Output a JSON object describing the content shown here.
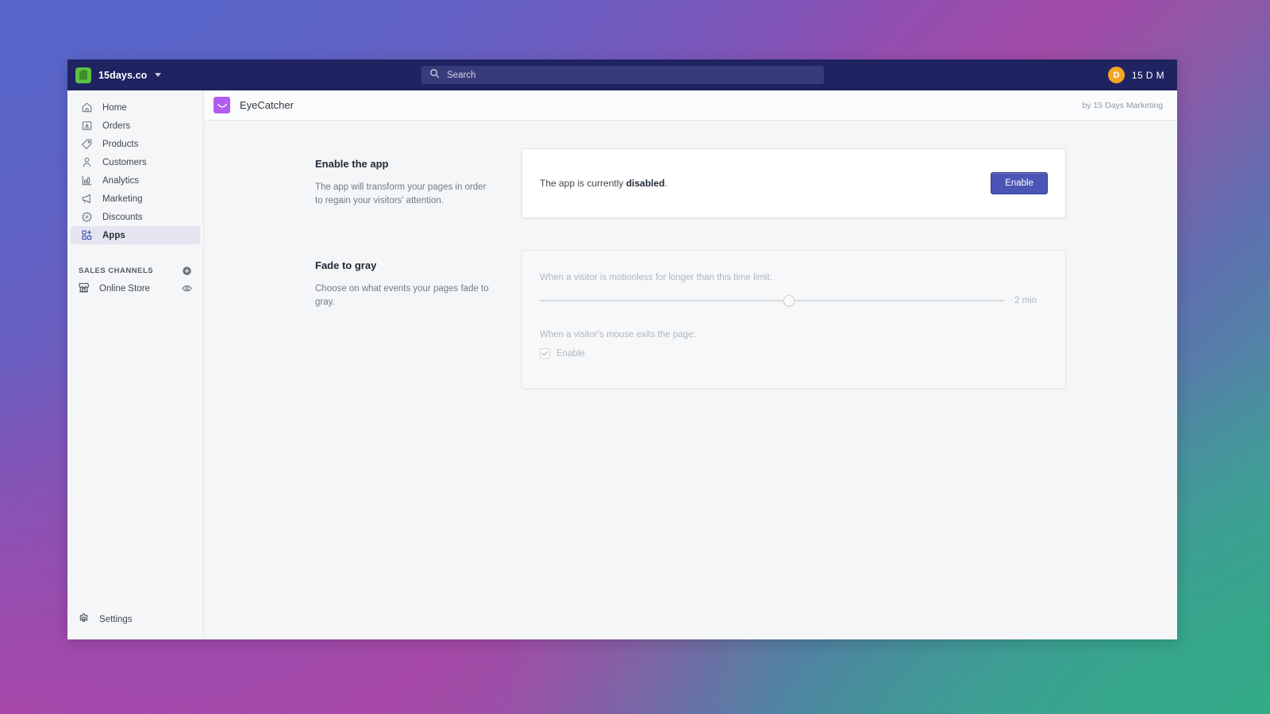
{
  "topbar": {
    "logo_icon": "shopify-bag-icon",
    "shop_name": "15days.co",
    "shop_caret_icon": "chevron-down-icon",
    "search": {
      "icon": "search-icon",
      "placeholder": "Search",
      "value": ""
    },
    "user": {
      "avatar_initial": "D",
      "avatar_color": "#f5a623",
      "label": "15 D M"
    }
  },
  "sidebar": {
    "items": [
      {
        "label": "Home",
        "icon": "home-icon",
        "active": false
      },
      {
        "label": "Orders",
        "icon": "orders-icon",
        "active": false
      },
      {
        "label": "Products",
        "icon": "tag-icon",
        "active": false
      },
      {
        "label": "Customers",
        "icon": "person-icon",
        "active": false
      },
      {
        "label": "Analytics",
        "icon": "bar-chart-icon",
        "active": false
      },
      {
        "label": "Marketing",
        "icon": "megaphone-icon",
        "active": false
      },
      {
        "label": "Discounts",
        "icon": "discount-icon",
        "active": false
      },
      {
        "label": "Apps",
        "icon": "apps-grid-icon",
        "active": true
      }
    ],
    "sales_channels": {
      "heading": "SALES CHANNELS",
      "add_icon": "plus-circle-icon",
      "items": [
        {
          "label": "Online Store",
          "icon": "storefront-icon",
          "trailing_icon": "eye-icon"
        }
      ]
    },
    "settings": {
      "label": "Settings",
      "icon": "gear-icon"
    }
  },
  "app_header": {
    "app_icon": "eyecatcher-eye-icon",
    "app_icon_color": "#b15cf0",
    "title": "EyeCatcher",
    "developer": "by 15 Days Marketing"
  },
  "main": {
    "sections": [
      {
        "title": "Enable the app",
        "description": "The app will transform your pages in order to regain your visitors' attention.",
        "card": {
          "status_prefix": "The app is currently ",
          "status_value": "disabled",
          "status_suffix": ".",
          "button_label": "Enable"
        }
      },
      {
        "title": "Fade to gray",
        "description": "Choose on what events your pages fade to gray.",
        "card": {
          "slider_label": "When a visitor is motionless for longer than this time limit:",
          "slider_value_text": "2 min",
          "slider_percent": 53.5,
          "mouse_exit_label": "When a visitor's mouse exits the page:",
          "checkbox_label": "Enable",
          "checkbox_checked": true,
          "disabled": true
        }
      }
    ]
  },
  "theme": {
    "topbar_bg": "#1f2361",
    "primary_button": "#4a55b5",
    "active_nav_bg": "#e4e5f0",
    "page_bg": "#f4f6f8"
  }
}
